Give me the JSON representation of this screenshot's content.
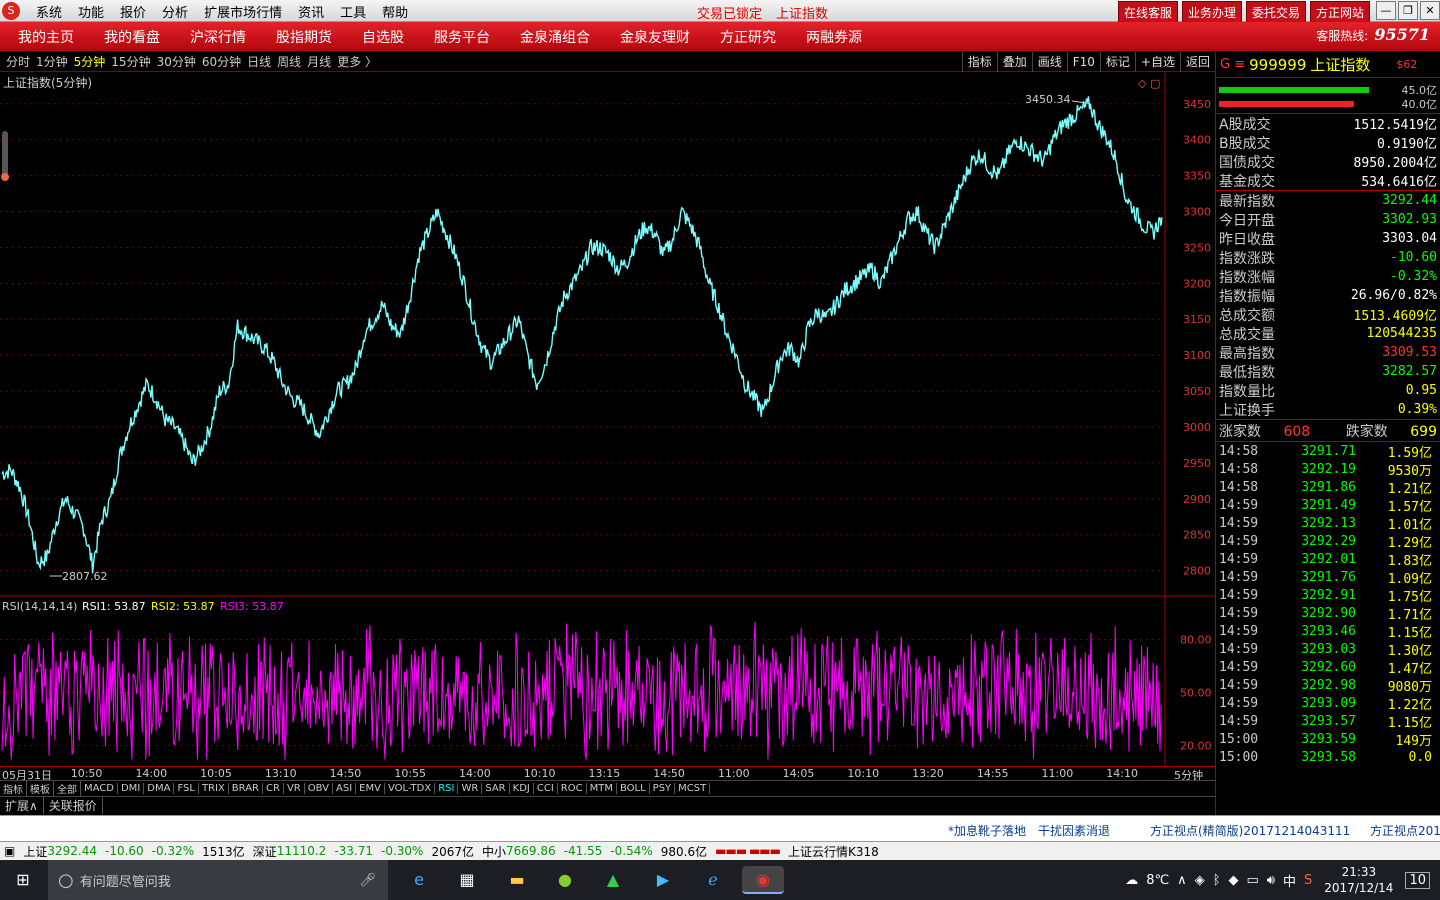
{
  "topmenu": {
    "items": [
      "系统",
      "功能",
      "报价",
      "分析",
      "扩展市场行情",
      "资讯",
      "工具",
      "帮助"
    ],
    "lock": "交易已锁定",
    "title": "上证指数"
  },
  "tradebtns": [
    "在线客服",
    "业务办理",
    "委托交易",
    "方正网站"
  ],
  "tabs": [
    "我的主页",
    "我的看盘",
    "沪深行情",
    "股指期货",
    "自选股",
    "服务平台",
    "金泉涌组合",
    "金泉友理财",
    "方正研究",
    "两融券源"
  ],
  "hotline": {
    "label": "客服热线:",
    "number": "95571"
  },
  "periods": [
    "分时",
    "1分钟",
    "5分钟",
    "15分钟",
    "30分钟",
    "60分钟",
    "日线",
    "周线",
    "月线",
    "更多 〉"
  ],
  "active_period": "5分钟",
  "chart_tools": [
    "指标",
    "叠加",
    "画线",
    "F10",
    "标记",
    "+自选",
    "返回"
  ],
  "chart": {
    "title": "上证指数(5分钟)",
    "high_label": "3450.34",
    "low_label": "2807.62",
    "rsi_label": "RSI(14,14,14)",
    "rsi1": "RSI1: 53.87",
    "rsi2": "RSI2: 53.87",
    "rsi3": "RSI3: 53.87",
    "period_tag": "5分钟"
  },
  "chart_data": {
    "type": "line",
    "title": "上证指数(5分钟)",
    "ylim": [
      2780,
      3465
    ],
    "yticks": [
      2800,
      2850,
      2900,
      2950,
      3000,
      3050,
      3100,
      3150,
      3200,
      3250,
      3300,
      3350,
      3400,
      3450
    ],
    "x": [
      "05月31日",
      "10:50",
      "14:00",
      "10:05",
      "13:10",
      "14:50",
      "10:55",
      "14:00",
      "10:10",
      "13:15",
      "14:50",
      "11:00",
      "14:05",
      "10:10",
      "13:20",
      "14:55",
      "11:00",
      "14:10"
    ],
    "series": [
      {
        "values": [
          2935,
          2940,
          2915,
          2870,
          2810,
          2820,
          2870,
          2900,
          2880,
          2860,
          2808,
          2870,
          2900,
          2960,
          3000,
          3030,
          3060,
          3040,
          3010,
          3000,
          2980,
          2950,
          2970,
          3000,
          3050,
          3060,
          3140,
          3130,
          3120,
          3110,
          3090,
          3060,
          3040,
          3030,
          3010,
          2990,
          3020,
          3050,
          3060,
          3080,
          3130,
          3150,
          3170,
          3140,
          3130,
          3180,
          3240,
          3270,
          3300,
          3270,
          3240,
          3200,
          3150,
          3110,
          3090,
          3110,
          3130,
          3150,
          3100,
          3060,
          3090,
          3140,
          3180,
          3200,
          3220,
          3250,
          3250,
          3240,
          3220,
          3230,
          3260,
          3280,
          3270,
          3240,
          3260,
          3300,
          3280,
          3250,
          3200,
          3170,
          3130,
          3100,
          3060,
          3040,
          3020,
          3060,
          3100,
          3110,
          3090,
          3140,
          3160,
          3150,
          3170,
          3190,
          3200,
          3210,
          3220,
          3200,
          3230,
          3260,
          3290,
          3300,
          3270,
          3250,
          3280,
          3310,
          3340,
          3370,
          3380,
          3360,
          3350,
          3380,
          3400,
          3390,
          3380,
          3370,
          3400,
          3420,
          3430,
          3440,
          3450,
          3420,
          3400,
          3370,
          3320,
          3300,
          3280,
          3270,
          3292
        ]
      }
    ],
    "rsi": {
      "ylim": [
        10,
        95
      ],
      "yticks": [
        20.0,
        50.0,
        80.0
      ],
      "last": 53.87
    }
  },
  "rpanel": {
    "code": "999999",
    "name": "上证指数",
    "tag": "$62",
    "bars": [
      {
        "value": "45.0亿",
        "color": "#11cc11",
        "frac": 0.62
      },
      {
        "value": "40.0亿",
        "color": "#ee2222",
        "frac": 0.56
      }
    ],
    "volumes": [
      {
        "label": "A股成交",
        "value": "1512.5419亿"
      },
      {
        "label": "B股成交",
        "value": "0.9190亿"
      },
      {
        "label": "国债成交",
        "value": "8950.2004亿"
      },
      {
        "label": "基金成交",
        "value": "534.6416亿"
      }
    ],
    "stats": [
      {
        "label": "最新指数",
        "value": "3292.44",
        "color": "green"
      },
      {
        "label": "今日开盘",
        "value": "3302.93",
        "color": "green"
      },
      {
        "label": "昨日收盘",
        "value": "3303.04",
        "color": "white"
      },
      {
        "label": "指数涨跌",
        "value": "-10.60",
        "color": "green"
      },
      {
        "label": "指数涨幅",
        "value": "-0.32%",
        "color": "green"
      },
      {
        "label": "指数振幅",
        "value": "26.96/0.82%",
        "color": "white"
      },
      {
        "label": "总成交额",
        "value": "1513.4609亿",
        "color": "yellow"
      },
      {
        "label": "总成交量",
        "value": "120544235",
        "color": "yellow"
      },
      {
        "label": "最高指数",
        "value": "3309.53",
        "color": "red"
      },
      {
        "label": "最低指数",
        "value": "3282.57",
        "color": "green"
      },
      {
        "label": "指数量比",
        "value": "0.95",
        "color": "yellow"
      },
      {
        "label": "上证换手",
        "value": "0.39%",
        "color": "yellow"
      }
    ],
    "updown": {
      "up_label": "涨家数",
      "up": "608",
      "down_label": "跌家数",
      "down": "699"
    },
    "ticks": [
      [
        "14:58",
        "3291.71",
        "1.59亿"
      ],
      [
        "14:58",
        "3292.19",
        "9530万"
      ],
      [
        "14:58",
        "3291.86",
        "1.21亿"
      ],
      [
        "14:59",
        "3291.49",
        "1.57亿"
      ],
      [
        "14:59",
        "3292.13",
        "1.01亿"
      ],
      [
        "14:59",
        "3292.29",
        "1.29亿"
      ],
      [
        "14:59",
        "3292.01",
        "1.83亿"
      ],
      [
        "14:59",
        "3291.76",
        "1.09亿"
      ],
      [
        "14:59",
        "3292.91",
        "1.75亿"
      ],
      [
        "14:59",
        "3292.90",
        "1.71亿"
      ],
      [
        "14:59",
        "3293.46",
        "1.15亿"
      ],
      [
        "14:59",
        "3293.03",
        "1.30亿"
      ],
      [
        "14:59",
        "3292.60",
        "1.47亿"
      ],
      [
        "14:59",
        "3292.98",
        "9080万"
      ],
      [
        "14:59",
        "3293.09",
        "1.22亿"
      ],
      [
        "14:59",
        "3293.57",
        "1.15亿"
      ],
      [
        "15:00",
        "3293.59",
        "149万"
      ],
      [
        "15:00",
        "3293.58",
        "0.0"
      ]
    ]
  },
  "indicators": [
    "指标",
    "模板",
    "全部",
    "MACD",
    "DMI",
    "DMA",
    "FSL",
    "TRIX",
    "BRAR",
    "CR",
    "VR",
    "OBV",
    "ASI",
    "EMV",
    "VOL-TDX",
    "RSI",
    "WR",
    "SAR",
    "KDJ",
    "CCI",
    "ROC",
    "MTM",
    "BOLL",
    "PSY",
    "MCST"
  ],
  "active_indicator": "RSI",
  "extbar": [
    "扩展∧",
    "关联报价"
  ],
  "infobar": [
    "*加息靴子落地",
    "干扰因素消退",
    "方正视点(精简版)20171214043111",
    "方正视点201"
  ],
  "statusbar": {
    "sh_label": "上证",
    "sh_val": "3292.44",
    "sh_chg": "-10.60",
    "sh_pct": "-0.32%",
    "sh_amt": "1513亿",
    "sz_label": "深证",
    "sz_val": "11110.2",
    "sz_chg": "-33.71",
    "sz_pct": "-0.30%",
    "sz_amt": "2067亿",
    "zx_label": "中小",
    "zx_val": "7669.86",
    "zx_chg": "-41.55",
    "zx_pct": "-0.54%",
    "zx_amt": "980.6亿",
    "cloud": "上证云行情K318"
  },
  "taskbar": {
    "search_placeholder": "有问题尽管问我",
    "weather": "8℃",
    "ime": "中",
    "time": "21:33",
    "date": "2017/12/14",
    "notif": "10"
  }
}
